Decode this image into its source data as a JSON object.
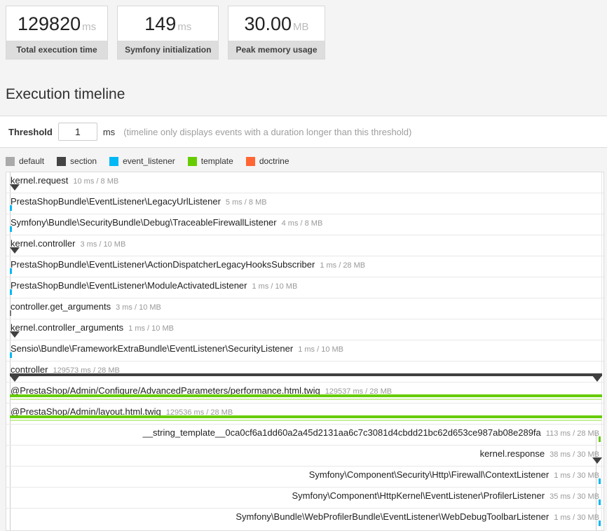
{
  "metrics": [
    {
      "value": "129820",
      "unit": "ms",
      "label": "Total execution time"
    },
    {
      "value": "149",
      "unit": "ms",
      "label": "Symfony initialization"
    },
    {
      "value": "30.00",
      "unit": "MB",
      "label": "Peak memory usage"
    }
  ],
  "section_title": "Execution timeline",
  "threshold": {
    "label": "Threshold",
    "value": "1",
    "unit": "ms",
    "hint": "(timeline only displays events with a duration longer than this threshold)"
  },
  "colors": {
    "default": "#777777",
    "section": "#404040",
    "event_listener": "#00b8f5",
    "template": "#66cc00",
    "template_light": "#9ae24c",
    "doctrine": "#ff6633"
  },
  "legend": [
    {
      "label": "default",
      "color": "#aaaaaa"
    },
    {
      "label": "section",
      "color": "#444444"
    },
    {
      "label": "event_listener",
      "color": "#00b8f5"
    },
    {
      "label": "template",
      "color": "#66cc00"
    },
    {
      "label": "doctrine",
      "color": "#ff6633"
    }
  ],
  "timeline": {
    "rows": [
      {
        "name": "kernel.request",
        "meta": "10 ms / 8 MB",
        "marker": "triangle",
        "align": "left"
      },
      {
        "name": "PrestaShopBundle\\EventListener\\LegacyUrlListener",
        "meta": "5 ms / 8 MB",
        "marker": "bar",
        "category": "event_listener",
        "align": "left"
      },
      {
        "name": "Symfony\\Bundle\\SecurityBundle\\Debug\\TraceableFirewallListener",
        "meta": "4 ms / 8 MB",
        "marker": "bar",
        "category": "event_listener",
        "align": "left"
      },
      {
        "name": "kernel.controller",
        "meta": "3 ms / 10 MB",
        "marker": "triangle",
        "align": "left"
      },
      {
        "name": "PrestaShopBundle\\EventListener\\ActionDispatcherLegacyHooksSubscriber",
        "meta": "1 ms / 28 MB",
        "marker": "bar",
        "category": "event_listener",
        "align": "left"
      },
      {
        "name": "PrestaShopBundle\\EventListener\\ModuleActivatedListener",
        "meta": "1 ms / 10 MB",
        "marker": "bar",
        "category": "event_listener",
        "align": "left"
      },
      {
        "name": "controller.get_arguments",
        "meta": "3 ms / 10 MB",
        "marker": "bar",
        "category": "default",
        "align": "left"
      },
      {
        "name": "kernel.controller_arguments",
        "meta": "1 ms / 10 MB",
        "marker": "triangle",
        "align": "left"
      },
      {
        "name": "Sensio\\Bundle\\FrameworkExtraBundle\\EventListener\\SecurityListener",
        "meta": "1 ms / 10 MB",
        "marker": "bar",
        "category": "event_listener",
        "align": "left"
      },
      {
        "name": "controller",
        "meta": "129573 ms / 28 MB",
        "marker": "section-full",
        "align": "left"
      },
      {
        "name": "@PrestaShop/Admin/Configure/AdvancedParameters/performance.html.twig",
        "meta": "129537 ms / 28 MB",
        "marker": "template-full",
        "align": "left"
      },
      {
        "name": "@PrestaShop/Admin/layout.html.twig",
        "meta": "129536 ms / 28 MB",
        "marker": "template-full",
        "align": "left"
      },
      {
        "name": "__string_template__0ca0cf6a1dd60a2a45d2131aa6c7c3081d4cbdd21bc62d653ce987ab08e289fa",
        "meta": "113 ms / 28 MB",
        "marker": "bar",
        "category": "template",
        "align": "right"
      },
      {
        "name": "kernel.response",
        "meta": "38 ms / 30 MB",
        "marker": "triangle",
        "align": "right"
      },
      {
        "name": "Symfony\\Component\\Security\\Http\\Firewall\\ContextListener",
        "meta": "1 ms / 30 MB",
        "marker": "bar",
        "category": "event_listener",
        "align": "right"
      },
      {
        "name": "Symfony\\Component\\HttpKernel\\EventListener\\ProfilerListener",
        "meta": "35 ms / 30 MB",
        "marker": "bar",
        "category": "event_listener",
        "align": "right"
      },
      {
        "name": "Symfony\\Bundle\\WebProfilerBundle\\EventListener\\WebDebugToolbarListener",
        "meta": "1 ms / 30 MB",
        "marker": "bar",
        "category": "event_listener",
        "align": "right"
      }
    ]
  }
}
